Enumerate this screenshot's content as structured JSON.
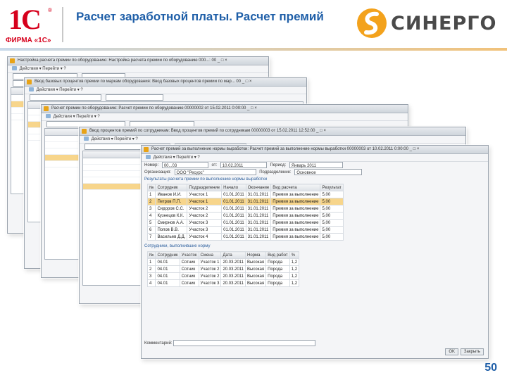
{
  "slide": {
    "title": "Расчет заработной платы. Расчет премий",
    "page_number": "50",
    "logo_left": {
      "mark": "1С",
      "registered": "®",
      "caption": "ФИРМА «1С»"
    },
    "logo_right": {
      "word": "СИНЕРГО"
    }
  },
  "windows": [
    {
      "title": "Настройка расчета премии по оборудованию: Настройка расчета премии по оборудованию 000...: 00 _ □ ×",
      "toolbar": "Действия ▾  Перейти ▾  ?"
    },
    {
      "title": "Ввод базовых процентов премии по маркам оборудования: Ввод базовых процентов премии по мар... 00 _ □ ×",
      "toolbar": "Действия ▾  Перейти ▾  ?"
    },
    {
      "title": "Расчет премии по оборудованию: Расчет премии по оборудованию 00000002 от 15.02.2011 0:00:00 _ □ ×",
      "toolbar": "Действия ▾  Перейти ▾  ?"
    },
    {
      "title": "Ввод процентов премий по сотрудникам: Ввод процентов премий по сотрудникам 00000003 от 15.02.2011 12:52:00 _ □ ×",
      "toolbar": "Действия ▾  Перейти ▾  ?"
    },
    {
      "title": "Расчет премий за выполнение нормы выработки: Расчет премий за выполнение нормы выработки 00000003 от 10.02.2011 0:00:00 _ □ ×",
      "toolbar": "Действия ▾  Перейти ▾  ?"
    }
  ],
  "front": {
    "fields": {
      "number_label": "Номер:",
      "number_value": "00...03",
      "date_label": "от:",
      "date_value": "10.02.2011",
      "period_label": "Период:",
      "period_value": "Январь 2011",
      "org_label": "Организация:",
      "org_value": "ООО \"Ресурс\"",
      "dept_label": "Подразделение:",
      "dept_value": "Основное",
      "section1": "Результаты расчета премии по выполнению нормы выработки",
      "section2": "Сотрудники, выполнившие норму"
    },
    "table1": {
      "headers": [
        "№",
        "Сотрудник",
        "Подразделение",
        "Начало",
        "Окончание",
        "Вид расчета",
        "Результат"
      ],
      "rows": [
        [
          "1",
          "Иванов И.И.",
          "Участок 1",
          "01.01.2011",
          "31.01.2011",
          "Премия за выполнение",
          "5,00"
        ],
        [
          "2",
          "Петров П.П.",
          "Участок 1",
          "01.01.2011",
          "31.01.2011",
          "Премия за выполнение",
          "5,00"
        ],
        [
          "3",
          "Сидоров С.С.",
          "Участок 2",
          "01.01.2011",
          "31.01.2011",
          "Премия за выполнение",
          "5,00"
        ],
        [
          "4",
          "Кузнецов К.К.",
          "Участок 2",
          "01.01.2011",
          "31.01.2011",
          "Премия за выполнение",
          "5,00"
        ],
        [
          "5",
          "Смирнов А.А.",
          "Участок 3",
          "01.01.2011",
          "31.01.2011",
          "Премия за выполнение",
          "5,00"
        ],
        [
          "6",
          "Попов В.В.",
          "Участок 3",
          "01.01.2011",
          "31.01.2011",
          "Премия за выполнение",
          "5,00"
        ],
        [
          "7",
          "Васильев Д.Д.",
          "Участок 4",
          "01.01.2011",
          "31.01.2011",
          "Премия за выполнение",
          "5,00"
        ]
      ]
    },
    "table2": {
      "headers": [
        "№",
        "Сотрудник",
        "Участок",
        "Смена",
        "Дата",
        "Норма",
        "Вид работ",
        "%"
      ],
      "rows": [
        [
          "1",
          "04.01",
          "Сотник",
          "Участок 1",
          "20.03.2011",
          "Высокая",
          "Порода",
          "1,2"
        ],
        [
          "2",
          "04.01",
          "Сотник",
          "Участок 2",
          "20.03.2011",
          "Высокая",
          "Порода",
          "1,2"
        ],
        [
          "3",
          "04.01",
          "Сотник",
          "Участок 2",
          "20.03.2011",
          "Высокая",
          "Порода",
          "1,2"
        ],
        [
          "4",
          "04.01",
          "Сотник",
          "Участок 3",
          "20.03.2011",
          "Высокая",
          "Порода",
          "1,2"
        ]
      ]
    },
    "footer": {
      "comment_label": "Комментарий:",
      "ok": "OK",
      "close": "Закрыть"
    }
  }
}
